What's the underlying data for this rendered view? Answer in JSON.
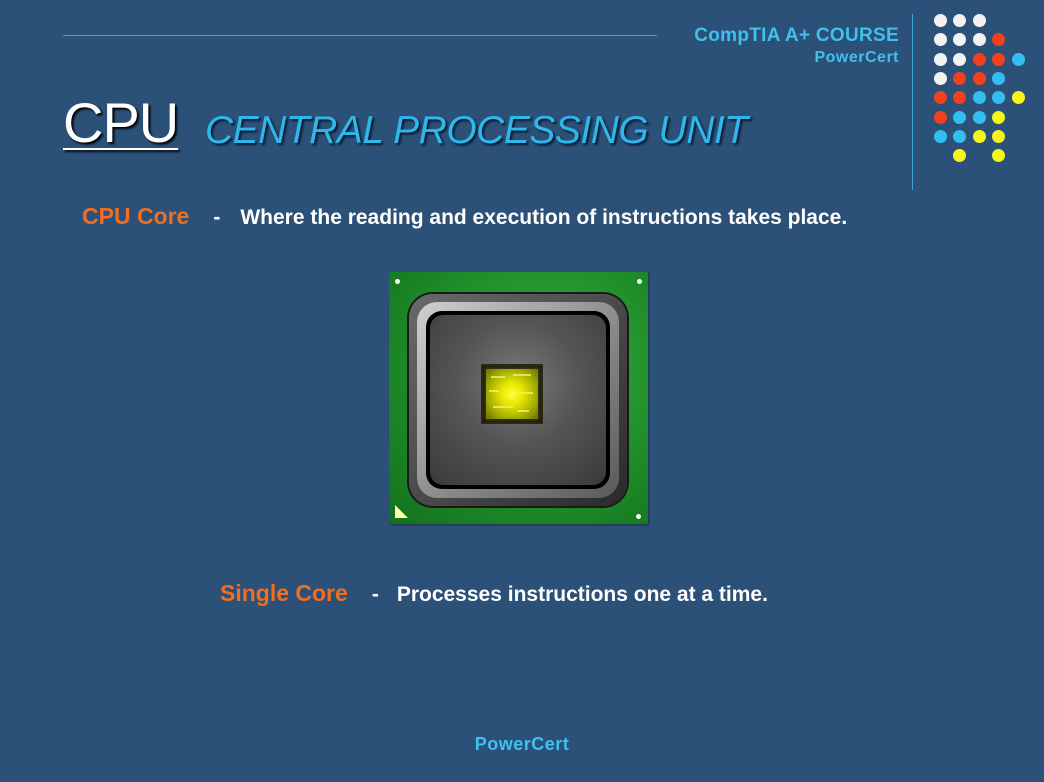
{
  "header": {
    "course_title": "CompTIA A+ COURSE",
    "brand": "PowerCert"
  },
  "title": {
    "acronym": "CPU",
    "full_name": "CENTRAL PROCESSING UNIT"
  },
  "definitions": [
    {
      "term": "CPU Core",
      "separator": "-",
      "description": "Where the reading and execution of instructions takes place."
    },
    {
      "term": "Single Core",
      "separator": "-",
      "description": "Processes instructions one at a time."
    }
  ],
  "footer": {
    "brand": "PowerCert"
  },
  "colors": {
    "background": "#2c5179",
    "accent_blue": "#3fc1ee",
    "term_orange": "#f06d21",
    "dot_white": "#f2f2f2",
    "dot_red": "#f2401c",
    "dot_blue": "#33bef0",
    "dot_yellow": "#f5f51c"
  },
  "image": {
    "icon": "cpu-chip-icon"
  }
}
